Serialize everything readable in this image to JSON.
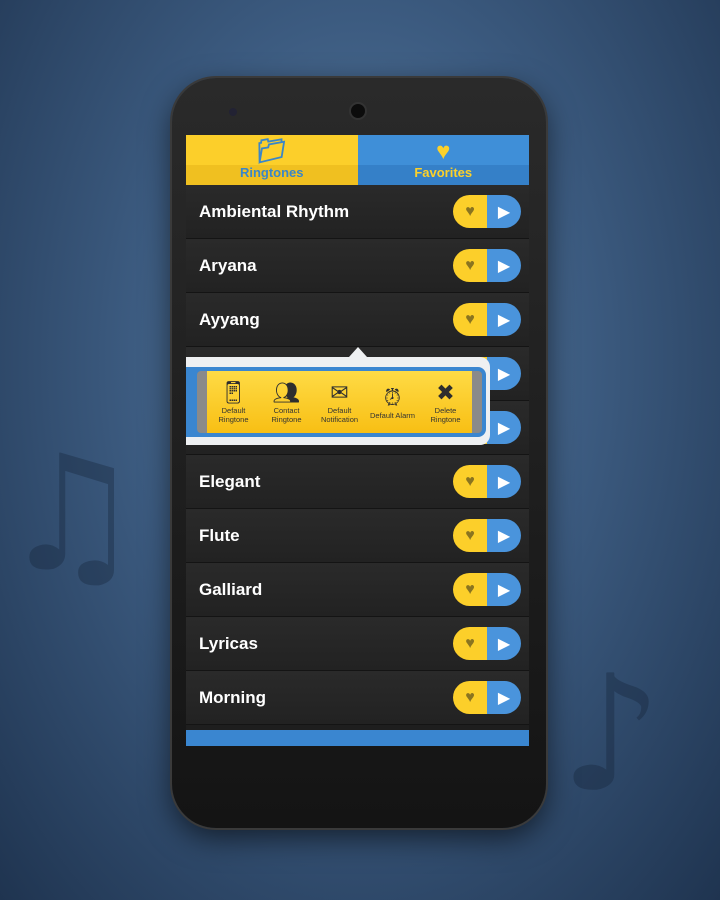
{
  "tabs": [
    {
      "label": "Ringtones",
      "icon": "music-folder-icon",
      "active": true
    },
    {
      "label": "Favorites",
      "icon": "heart-icon"
    }
  ],
  "ringtones": [
    {
      "name": "Ambiental Rhythm"
    },
    {
      "name": "Aryana"
    },
    {
      "name": "Ayyang"
    },
    {
      "name": ""
    },
    {
      "name": ""
    },
    {
      "name": "Elegant"
    },
    {
      "name": "Flute"
    },
    {
      "name": "Galliard"
    },
    {
      "name": "Lyricas"
    },
    {
      "name": "Morning"
    }
  ],
  "popup": {
    "actions": [
      {
        "label": "Default Ringtone",
        "icon": "phone-ringing-icon"
      },
      {
        "label": "Contact Ringtone",
        "icon": "contacts-icon"
      },
      {
        "label": "Default Notification",
        "icon": "envelope-icon"
      },
      {
        "label": "Default Alarm",
        "icon": "alarm-clock-icon"
      },
      {
        "label": "Delete Ringtone",
        "icon": "delete-x-icon"
      }
    ]
  },
  "colors": {
    "yellow": "#fccf2a",
    "blue": "#3a86d0"
  }
}
